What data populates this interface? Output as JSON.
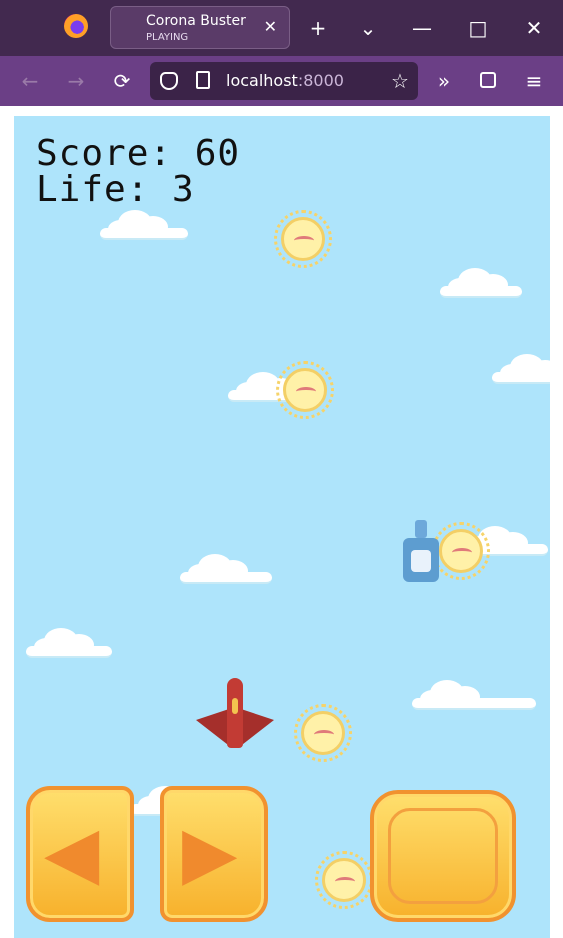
{
  "browser": {
    "tab": {
      "title": "Corona Buster",
      "subtitle": "PLAYING",
      "close_icon": "close-icon"
    },
    "toolbar": {
      "url_host": "localhost",
      "url_port": ":8000"
    },
    "icons": {
      "firefox": "firefox-icon",
      "new_tab": "+",
      "tab_list": "⌄",
      "minimize": "—",
      "maximize": "□",
      "close": "✕",
      "back": "←",
      "forward": "→",
      "reload": "⟳",
      "shield": "shield-icon",
      "page": "page-icon",
      "bookmark": "☆",
      "overflow": "»",
      "extensions": "puzzle-icon",
      "menu": "≡"
    }
  },
  "game": {
    "score_label": "Score: 60",
    "life_label": "Life: 3"
  }
}
